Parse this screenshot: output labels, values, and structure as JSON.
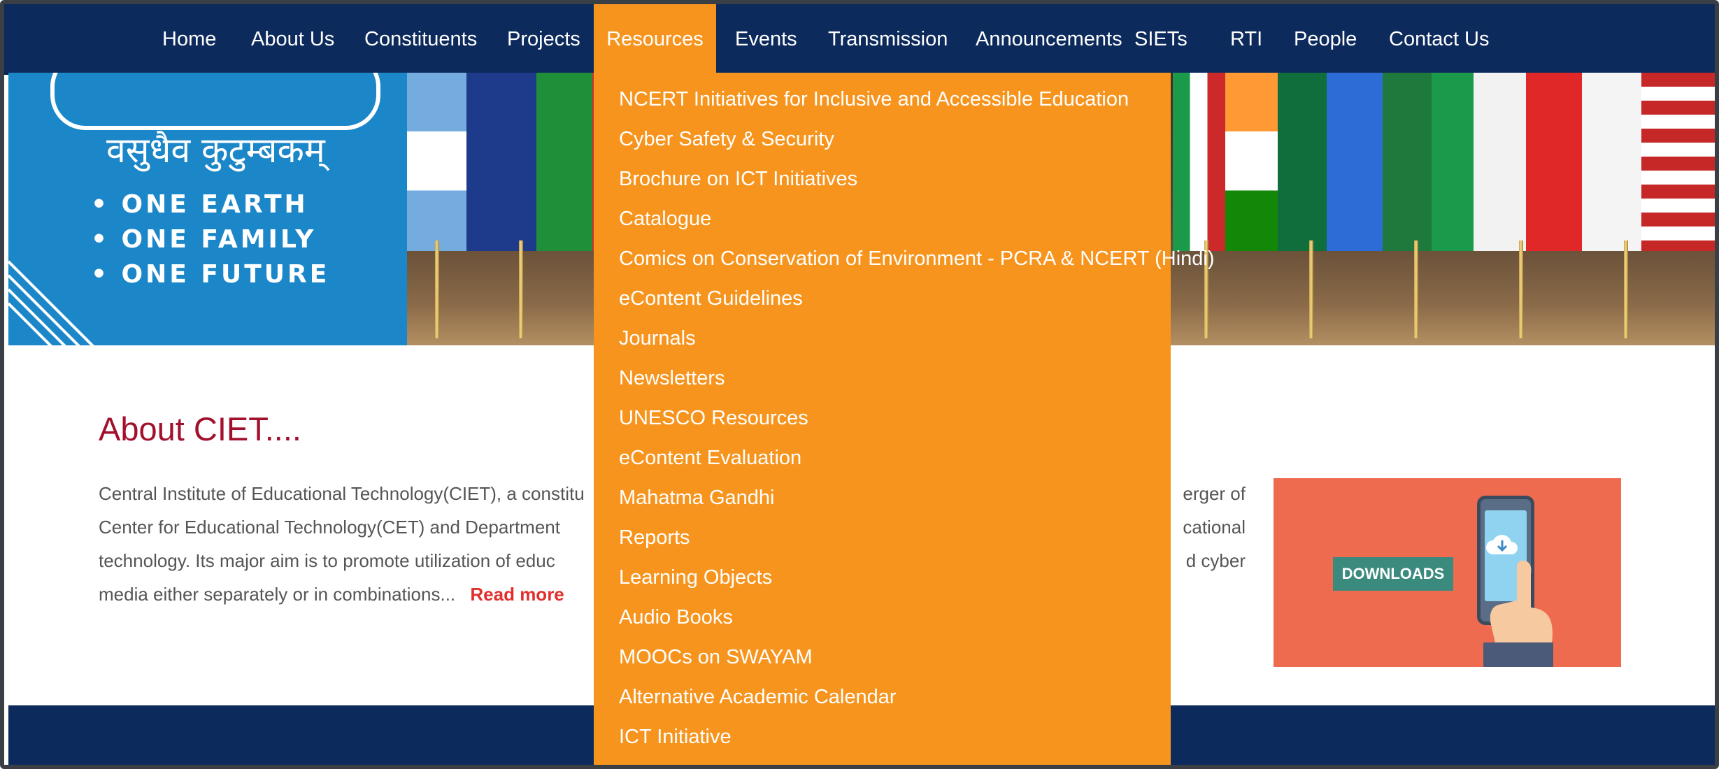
{
  "nav": {
    "items": [
      "Home",
      "About Us",
      "Constituents",
      "Projects",
      "Resources",
      "Events",
      "Transmission",
      "Announcements",
      "SIETs",
      "RTI",
      "People",
      "Contact Us"
    ],
    "active": "Resources"
  },
  "banner": {
    "sanskrit": "वसुधैव कुटुम्बकम्",
    "bullets": [
      "• ONE EARTH",
      "• ONE FAMILY",
      "• ONE FUTURE"
    ]
  },
  "resources_menu": [
    "NCERT Initiatives for Inclusive and Accessible Education",
    "Cyber Safety & Security",
    "Brochure on ICT Initiatives",
    "Catalogue",
    "Comics on Conservation of Environment - PCRA & NCERT (Hindi)",
    "eContent Guidelines",
    "Journals",
    "Newsletters",
    "UNESCO Resources",
    "eContent Evaluation",
    "Mahatma Gandhi",
    "Reports",
    "Learning Objects",
    "Audio Books",
    "MOOCs on SWAYAM",
    "Alternative Academic Calendar",
    "ICT Initiative"
  ],
  "about": {
    "title": "About CIET....",
    "lines": [
      "Central Institute of Educational Technology(CIET), a constitu",
      "Center for Educational Technology(CET) and Department",
      "technology. Its major aim is to promote utilization of educ",
      "media either separately or in combinations..."
    ],
    "lines_right": [
      "erger of",
      "cational",
      "d cyber"
    ],
    "read_more": "Read more"
  },
  "downloads": {
    "label": "DOWNLOADS"
  },
  "colors": {
    "nav_bg": "#0d2a5c",
    "accent": "#f7941d",
    "title": "#a2102c",
    "banner_blue": "#1b86c8"
  }
}
